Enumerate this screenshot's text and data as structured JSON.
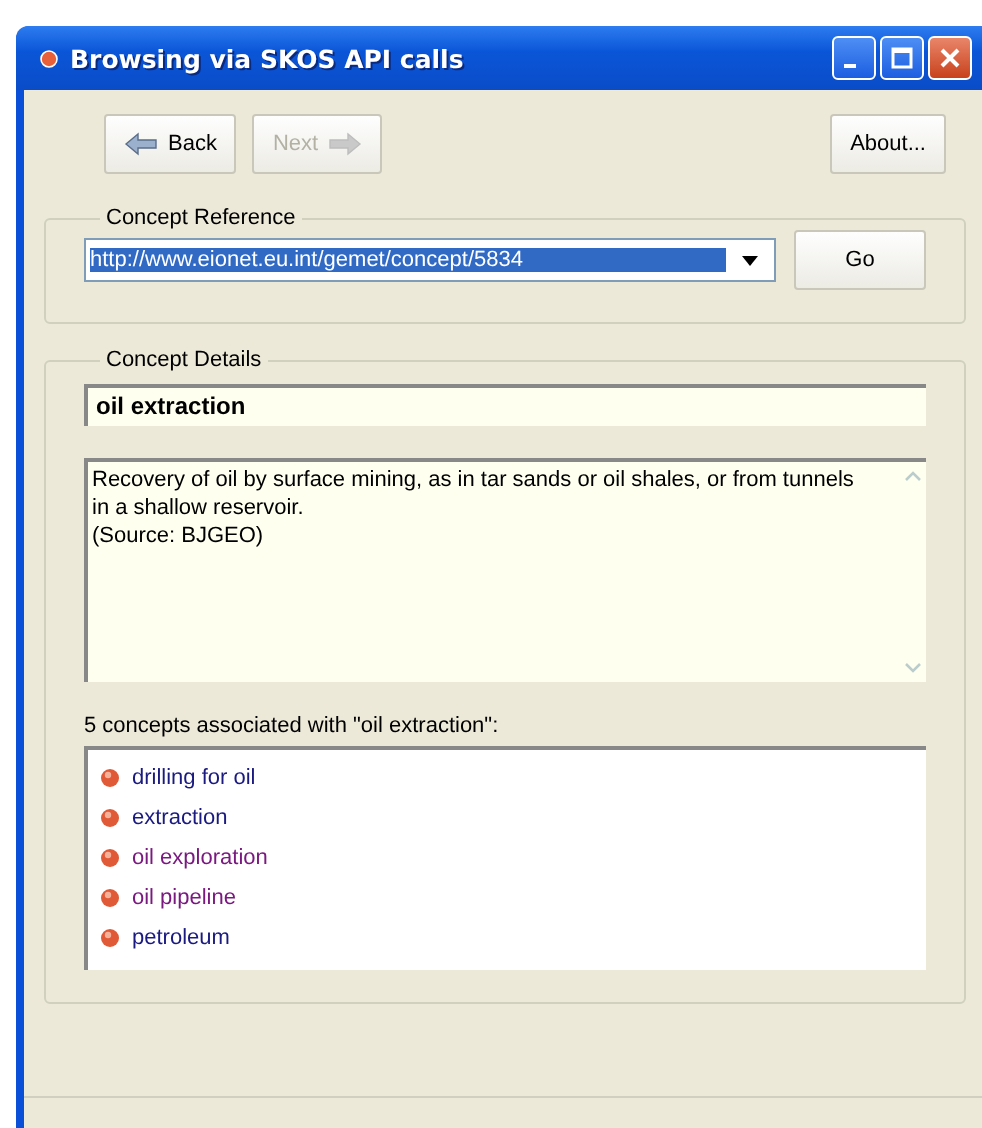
{
  "window": {
    "title": "Browsing via SKOS API calls"
  },
  "toolbar": {
    "buttons": [
      {
        "label": "Back",
        "kind": "back",
        "disabled": false
      },
      {
        "label": "Next",
        "kind": "next",
        "disabled": true
      },
      {
        "label": "About...",
        "kind": "plain",
        "disabled": false
      }
    ]
  },
  "concept_reference": {
    "title": "Concept Reference",
    "value": "http://www.eionet.eu.int/gemet/concept/5834",
    "selected": true,
    "go_button": "Go"
  },
  "concept_details": {
    "title": "Concept Details",
    "name": "oil extraction",
    "definition": [
      "Recovery of oil by surface mining, as in tar sands or oil shales, or from tunnels in a shallow reservoir.",
      "(Source: BJGEO)"
    ],
    "associated_label": "5 concepts associated with \"oil extraction\":",
    "associated": [
      {
        "label": "drilling for oil",
        "visited": false
      },
      {
        "label": "extraction",
        "visited": false
      },
      {
        "label": "oil exploration",
        "visited": true
      },
      {
        "label": "oil pipeline",
        "visited": true
      },
      {
        "label": "petroleum",
        "visited": false
      }
    ]
  }
}
